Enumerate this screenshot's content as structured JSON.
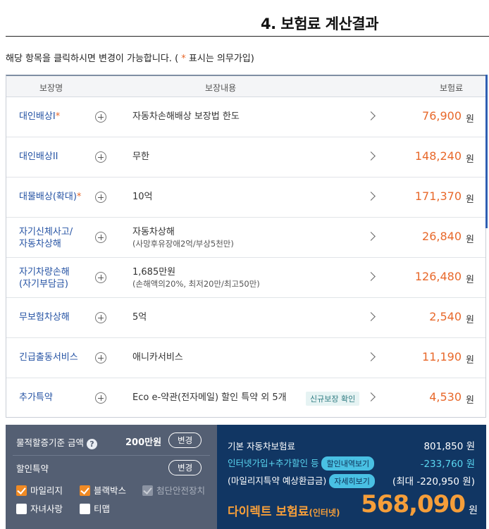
{
  "title": "4. 보험료 계산결과",
  "notice": {
    "before": "해당 항목을 클릭하시면 변경이 가능합니다. ( ",
    "star": "*",
    "after": " 표시는 의무가입)"
  },
  "table": {
    "headers": {
      "name": "보장명",
      "content": "보장내용",
      "premium": "보험료"
    },
    "rows": [
      {
        "name": "대인배상I",
        "required": "*",
        "desc": "자동차손해배상 보장법 한도",
        "sub": "",
        "tag": "",
        "amount": "76,900",
        "unit": "원"
      },
      {
        "name": "대인배상II",
        "required": "",
        "desc": "무한",
        "sub": "",
        "tag": "",
        "amount": "148,240",
        "unit": "원"
      },
      {
        "name": "대물배상(확대)",
        "required": "*",
        "desc": "10억",
        "sub": "",
        "tag": "",
        "amount": "171,370",
        "unit": "원"
      },
      {
        "name": "자기신체사고/",
        "name2": "자동차상해",
        "required": "",
        "desc": "자동차상해",
        "sub": "(사망후유장애2억/부상5천만)",
        "tag": "",
        "amount": "26,840",
        "unit": "원"
      },
      {
        "name": "자기차량손해",
        "name2": "(자기부담금)",
        "required": "",
        "desc": "1,685만원",
        "sub": "(손해액의20%, 최저20만/최고50만)",
        "tag": "",
        "amount": "126,480",
        "unit": "원"
      },
      {
        "name": "무보험차상해",
        "required": "",
        "desc": "5억",
        "sub": "",
        "tag": "",
        "amount": "2,540",
        "unit": "원"
      },
      {
        "name": "긴급출동서비스",
        "required": "",
        "desc": "애니카서비스",
        "sub": "",
        "tag": "",
        "amount": "11,190",
        "unit": "원"
      },
      {
        "name": "추가특약",
        "required": "",
        "desc": "Eco e-약관(전자메일) 할인 특약 외 5개",
        "sub": "",
        "tag": "신규보장 확인",
        "amount": "4,530",
        "unit": "원"
      }
    ]
  },
  "left_panel": {
    "threshold_label": "물적할증기준 금액",
    "help": "?",
    "threshold_value": "200만원",
    "change_label": "변경",
    "discount_label": "할인특약",
    "discount_change_label": "변경",
    "checks": [
      {
        "label": "마일리지",
        "state": "on"
      },
      {
        "label": "블랙박스",
        "state": "on"
      },
      {
        "label": "첨단안전장치",
        "state": "disabled"
      },
      {
        "label": "자녀사랑",
        "state": "off"
      },
      {
        "label": "티맵",
        "state": "off"
      }
    ]
  },
  "right_panel": {
    "base_label": "기본 자동차보험료",
    "base_value": "801,850 원",
    "internet_label": "인터넷가입+추가할인 등",
    "internet_btn": "할인내역보기",
    "internet_value": "-233,760 원",
    "mileage_label": "(마일리지특약 예상환급금)",
    "mileage_btn": "자세히보기",
    "mileage_value": "(최대 -220,950 원)",
    "direct_label": "다이렉트 보험료",
    "direct_sub": "(인터넷)",
    "total": "568,090",
    "total_unit": "원"
  }
}
